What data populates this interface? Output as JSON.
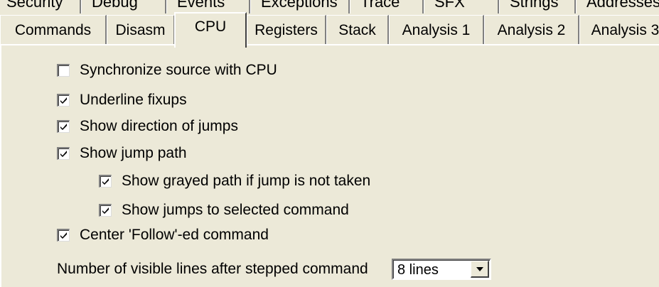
{
  "tabs_top": [
    {
      "label": "Security"
    },
    {
      "label": "Debug"
    },
    {
      "label": "Events"
    },
    {
      "label": "Exceptions"
    },
    {
      "label": "Trace"
    },
    {
      "label": "SFX"
    },
    {
      "label": "Strings"
    },
    {
      "label": "Addresses"
    }
  ],
  "tabs_main": [
    {
      "label": "Commands"
    },
    {
      "label": "Disasm"
    },
    {
      "label": "CPU",
      "active": true
    },
    {
      "label": "Registers"
    },
    {
      "label": "Stack"
    },
    {
      "label": "Analysis 1"
    },
    {
      "label": "Analysis 2"
    },
    {
      "label": "Analysis 3"
    }
  ],
  "options": [
    {
      "label": "Synchronize source with CPU",
      "checked": false
    },
    {
      "label": "Underline fixups",
      "checked": true
    },
    {
      "label": "Show direction of jumps",
      "checked": true
    },
    {
      "label": "Show jump path",
      "checked": true
    },
    {
      "label": "Show grayed path if jump is not taken",
      "checked": true
    },
    {
      "label": "Show jumps to selected command",
      "checked": true
    },
    {
      "label": "Center 'Follow'-ed command",
      "checked": true
    }
  ],
  "lines_setting": {
    "label": "Number of visible lines after stepped command",
    "value": "8 lines"
  },
  "icons": {
    "checkmark": "checkmark-icon",
    "dropdown": "chevron-down-icon"
  },
  "colors": {
    "panel_bg": "#ece9d8",
    "field_bg": "#ffffff",
    "shadow": "#808080"
  }
}
